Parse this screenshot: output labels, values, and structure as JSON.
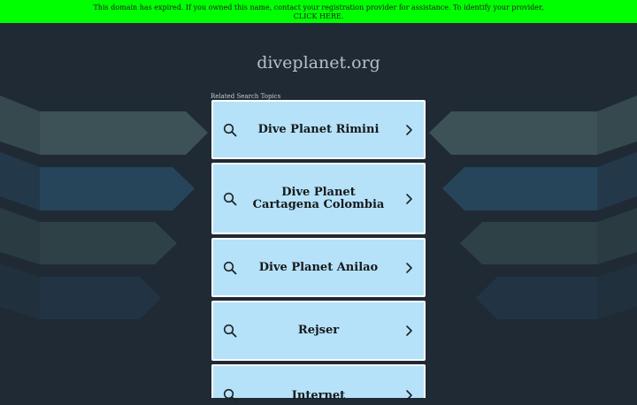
{
  "banner": {
    "text": "This domain has expired. If you owned this name, contact your registration provider for assistance. To identify your provider,",
    "link": "CLICK HERE."
  },
  "site": {
    "domain": "diveplanet.org"
  },
  "related": {
    "heading": "Related Search Topics",
    "items": [
      {
        "label": "Dive Planet Rimini"
      },
      {
        "label": "Dive Planet Cartagena Colombia"
      },
      {
        "label": "Dive Planet Anilao"
      },
      {
        "label": "Rejser"
      },
      {
        "label": "Internet"
      }
    ]
  },
  "icons": {
    "search": "search-icon",
    "chevron": "chevron-right-icon"
  },
  "colors": {
    "banner": "#00ff00",
    "background": "#1f2a35",
    "card": "#b5e2f8",
    "card_border": "#ffffff"
  }
}
